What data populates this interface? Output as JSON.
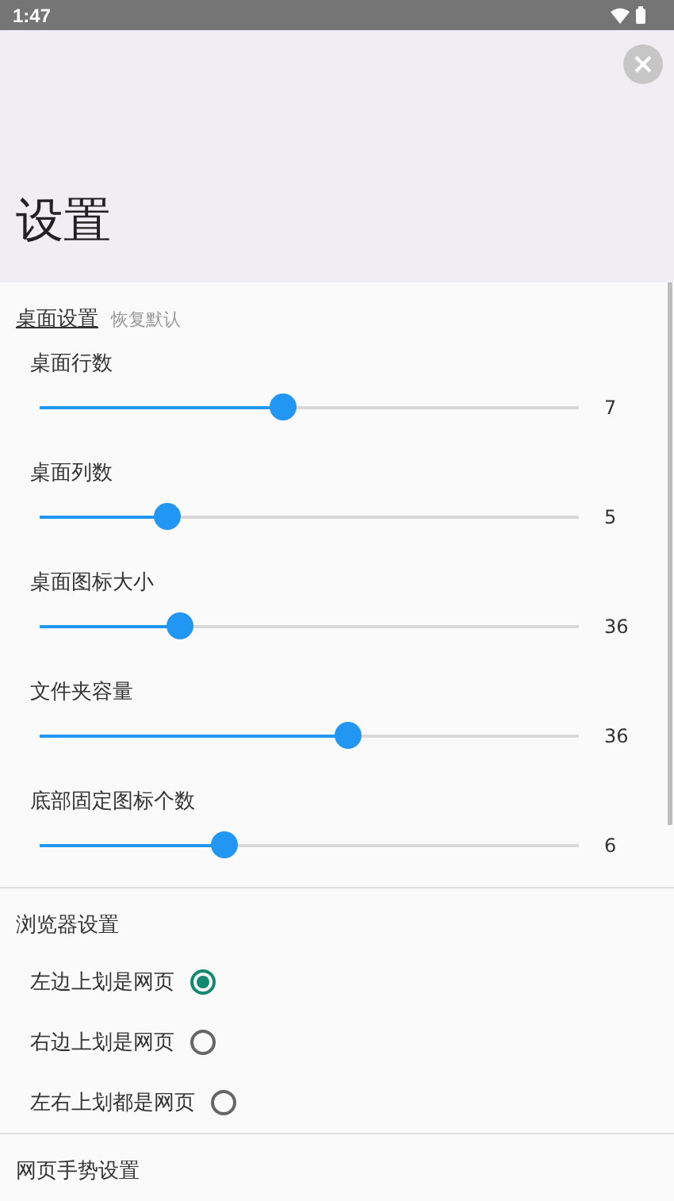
{
  "status_bar": {
    "time": "1:47"
  },
  "header": {
    "title": "设置"
  },
  "desktop_section": {
    "title": "桌面设置",
    "reset_link": "恢复默认",
    "sliders": [
      {
        "label": "桌面行数",
        "level": 0.45,
        "reading": "7"
      },
      {
        "label": "桌面列数",
        "level": 0.235,
        "reading": "5"
      },
      {
        "label": "桌面图标大小",
        "level": 0.26,
        "reading": "36"
      },
      {
        "label": "文件夹容量",
        "level": 0.57,
        "reading": "36"
      },
      {
        "label": "底部固定图标个数",
        "level": 0.34,
        "reading": "6"
      }
    ]
  },
  "browser_section": {
    "title": "浏览器设置",
    "options": [
      {
        "label": "左边上划是网页",
        "selected": true
      },
      {
        "label": "右边上划是网页",
        "selected": false
      },
      {
        "label": "左右上划都是网页",
        "selected": false
      }
    ]
  },
  "gesture_section": {
    "title": "网页手势设置"
  }
}
